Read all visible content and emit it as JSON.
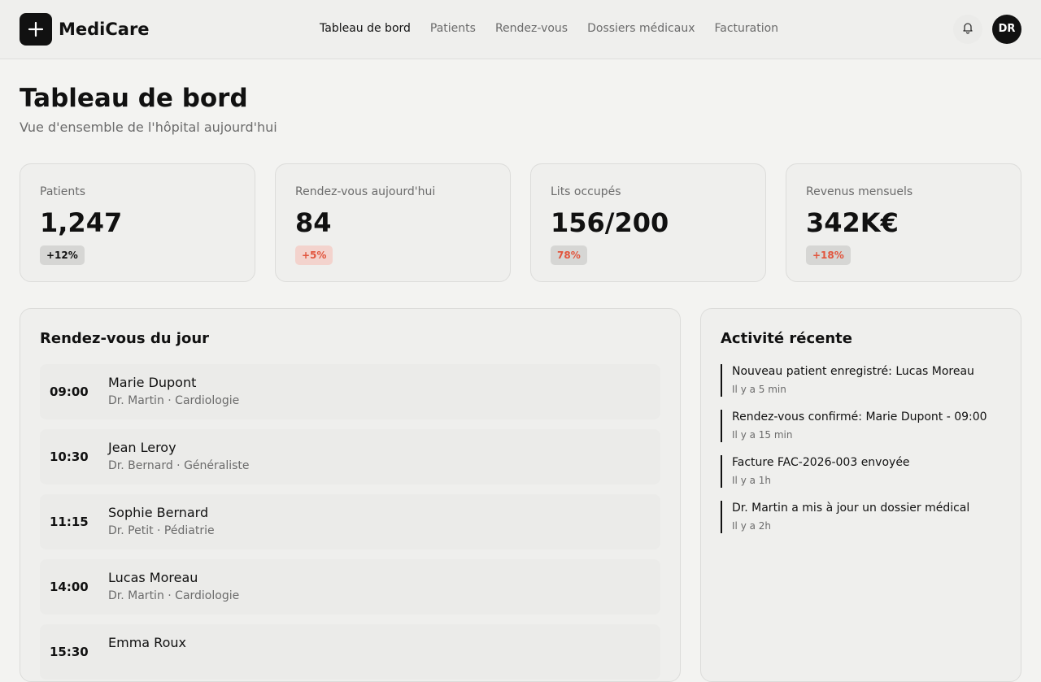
{
  "app": {
    "name": "MediCare"
  },
  "nav": {
    "items": [
      {
        "label": "Tableau de bord"
      },
      {
        "label": "Patients"
      },
      {
        "label": "Rendez-vous"
      },
      {
        "label": "Dossiers médicaux"
      },
      {
        "label": "Facturation"
      }
    ],
    "active": "Tableau de bord"
  },
  "user": {
    "initials": "DR"
  },
  "page": {
    "title": "Tableau de bord",
    "subtitle": "Vue d'ensemble de l'hôpital aujourd'hui"
  },
  "stats": [
    {
      "label": "Patients",
      "value": "1,247",
      "badge": "+12%"
    },
    {
      "label": "Rendez-vous aujourd'hui",
      "value": "84",
      "badge": "+5%"
    },
    {
      "label": "Lits occupés",
      "value": "156/200",
      "badge": "78%"
    },
    {
      "label": "Revenus mensuels",
      "value": "342K€",
      "badge": "+18%"
    }
  ],
  "appointments": {
    "title": "Rendez-vous du jour",
    "items": [
      {
        "time": "09:00",
        "patient": "Marie Dupont",
        "meta": "Dr. Martin · Cardiologie"
      },
      {
        "time": "10:30",
        "patient": "Jean Leroy",
        "meta": "Dr. Bernard · Généraliste"
      },
      {
        "time": "11:15",
        "patient": "Sophie Bernard",
        "meta": "Dr. Petit · Pédiatrie"
      },
      {
        "time": "14:00",
        "patient": "Lucas Moreau",
        "meta": "Dr. Martin · Cardiologie"
      },
      {
        "time": "15:30",
        "patient": "Emma Roux",
        "meta": ""
      }
    ]
  },
  "activity": {
    "title": "Activité récente",
    "items": [
      {
        "text": "Nouveau patient enregistré: Lucas Moreau",
        "time": "Il y a 5 min"
      },
      {
        "text": "Rendez-vous confirmé: Marie Dupont - 09:00",
        "time": "Il y a 15 min"
      },
      {
        "text": "Facture FAC-2026-003 envoyée",
        "time": "Il y a 1h"
      },
      {
        "text": "Dr. Martin a mis à jour un dossier médical",
        "time": "Il y a 2h"
      }
    ]
  },
  "icons": {
    "logo": "plus-icon",
    "notifications": "bell-icon"
  },
  "colors": {
    "accent": "#111111",
    "alert": "#e2553d",
    "background": "#f3f3f1"
  }
}
